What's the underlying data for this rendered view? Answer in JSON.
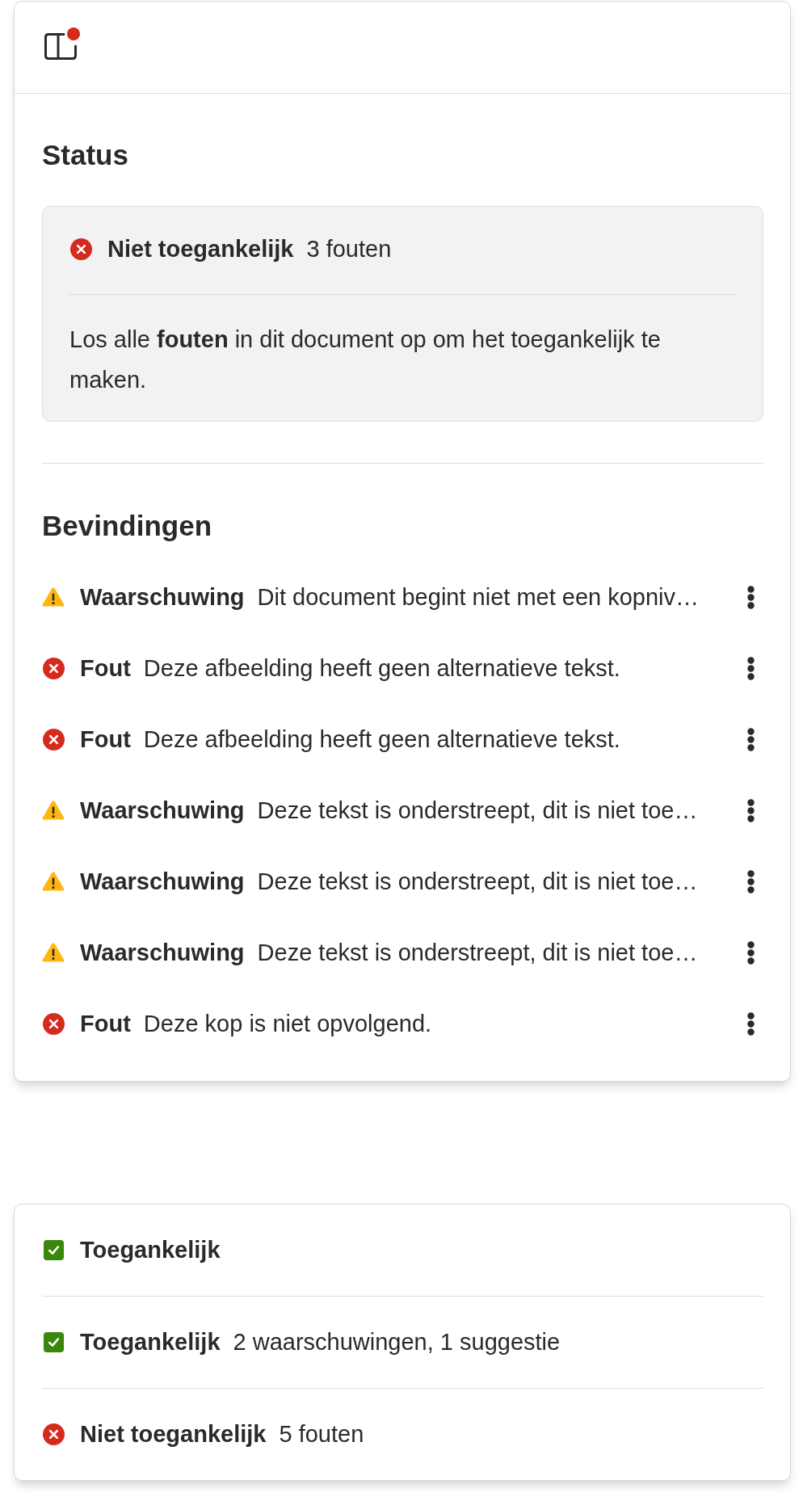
{
  "header": {
    "notification": true
  },
  "status": {
    "heading": "Status",
    "summary": {
      "kind": "error",
      "label": "Niet toegankelijk",
      "detail": "3 fouten"
    },
    "message": "Los alle **fouten** in dit document op om het toegankelijk te maken."
  },
  "findings": {
    "heading": "Bevindingen",
    "items": [
      {
        "kind": "warning",
        "label": "Waarschuwing",
        "message": "Dit document begint niet met een kopniv…"
      },
      {
        "kind": "error",
        "label": "Fout",
        "message": "Deze afbeelding heeft geen alternatieve tekst."
      },
      {
        "kind": "error",
        "label": "Fout",
        "message": "Deze afbeelding heeft geen alternatieve tekst."
      },
      {
        "kind": "warning",
        "label": "Waarschuwing",
        "message": "Deze tekst is onderstreept, dit is niet toe…"
      },
      {
        "kind": "warning",
        "label": "Waarschuwing",
        "message": "Deze tekst is onderstreept, dit is niet toe…"
      },
      {
        "kind": "warning",
        "label": "Waarschuwing",
        "message": "Deze tekst is onderstreept, dit is niet toe…"
      },
      {
        "kind": "error",
        "label": "Fout",
        "message": "Deze kop is niet opvolgend."
      }
    ]
  },
  "status_examples": [
    {
      "kind": "ok",
      "label": "Toegankelijk"
    },
    {
      "kind": "ok",
      "label": "Toegankelijk",
      "detail": "2 waarschuwingen, 1 suggestie"
    },
    {
      "kind": "error",
      "label": "Niet toegankelijk",
      "detail": "5 fouten"
    }
  ]
}
